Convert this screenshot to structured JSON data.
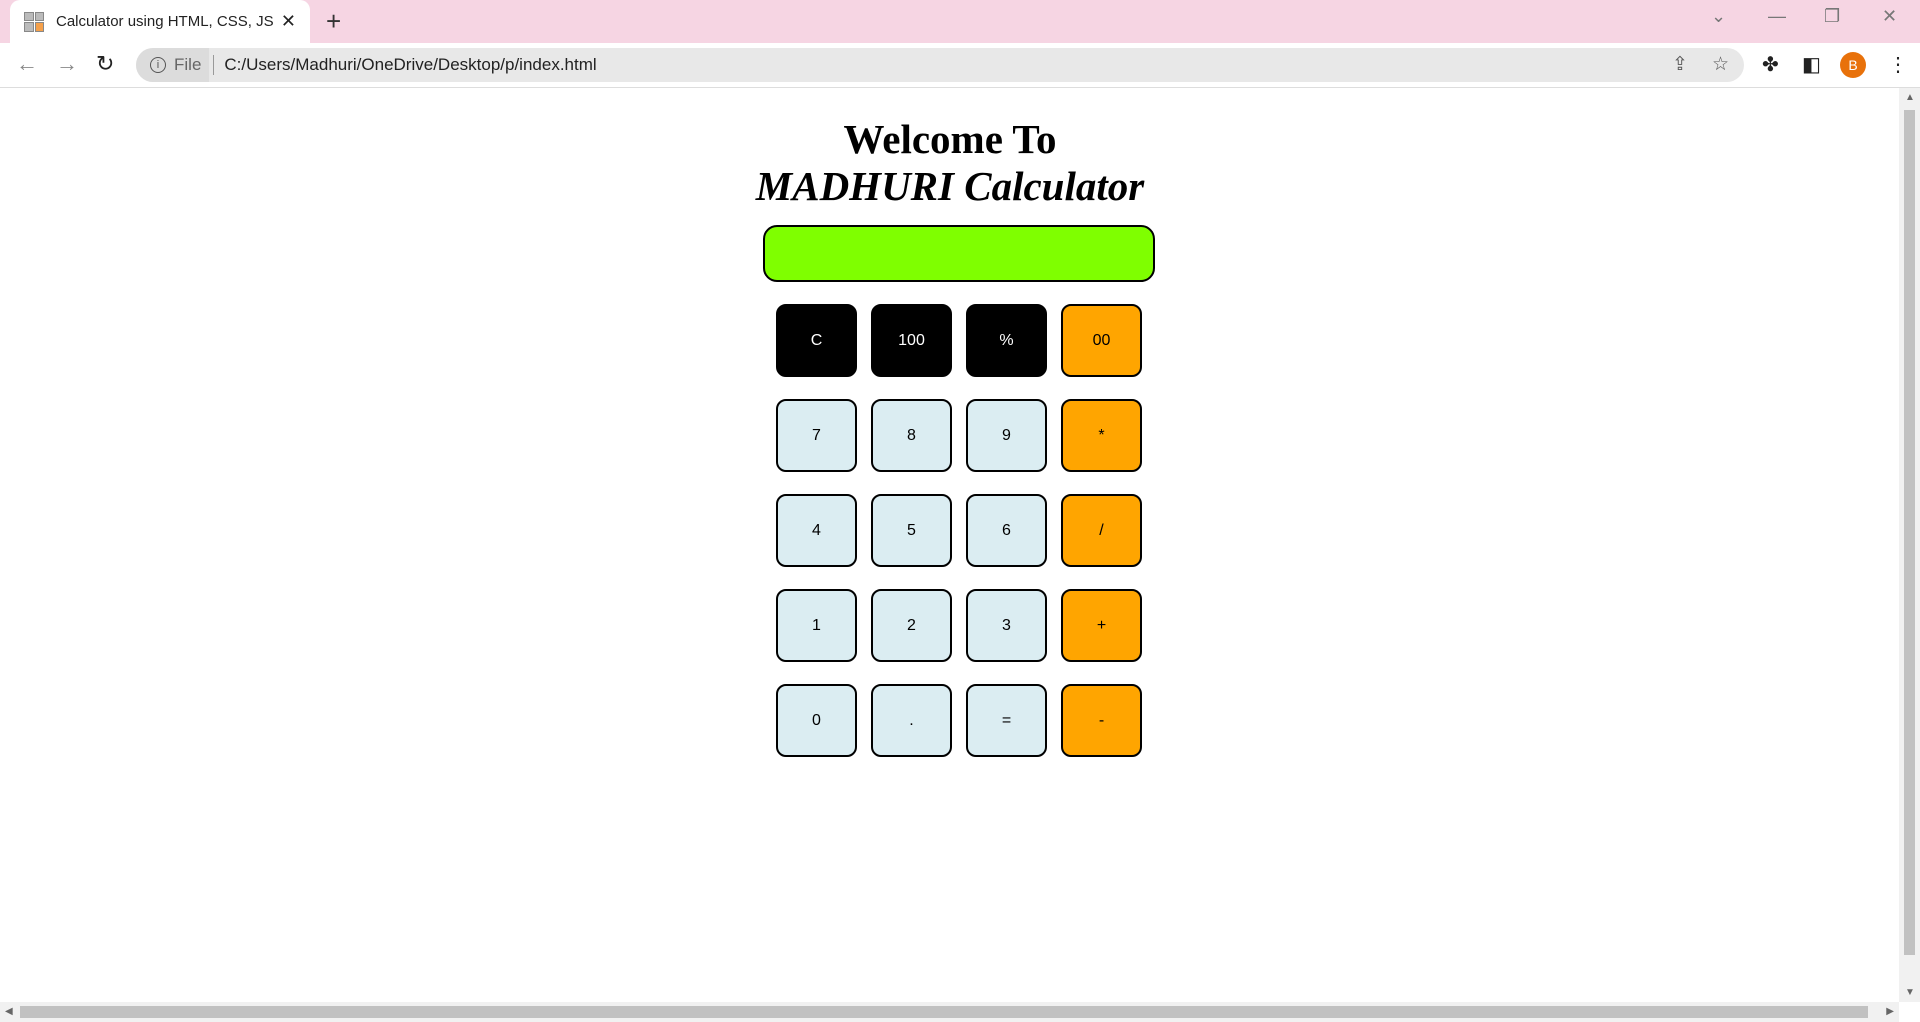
{
  "browser": {
    "tab_title": "Calculator using HTML, CSS, JS",
    "new_tab": "+",
    "close": "✕",
    "file_label": "File",
    "url": "C:/Users/Madhuri/OneDrive/Desktop/p/index.html",
    "profile_initial": "B"
  },
  "page": {
    "heading_line1": "Welcome To",
    "heading_line2": "MADHURI Calculator",
    "display_value": ""
  },
  "buttons": [
    {
      "label": "C",
      "style": "dark"
    },
    {
      "label": "100",
      "style": "dark"
    },
    {
      "label": "%",
      "style": "dark"
    },
    {
      "label": "00",
      "style": "op"
    },
    {
      "label": "7",
      "style": "num"
    },
    {
      "label": "8",
      "style": "num"
    },
    {
      "label": "9",
      "style": "num"
    },
    {
      "label": "*",
      "style": "op"
    },
    {
      "label": "4",
      "style": "num"
    },
    {
      "label": "5",
      "style": "num"
    },
    {
      "label": "6",
      "style": "num"
    },
    {
      "label": "/",
      "style": "op"
    },
    {
      "label": "1",
      "style": "num"
    },
    {
      "label": "2",
      "style": "num"
    },
    {
      "label": "3",
      "style": "num"
    },
    {
      "label": "+",
      "style": "op"
    },
    {
      "label": "0",
      "style": "num"
    },
    {
      "label": ".",
      "style": "num"
    },
    {
      "label": "=",
      "style": "num"
    },
    {
      "label": "-",
      "style": "op"
    }
  ],
  "colors": {
    "display": "#7fff00",
    "operator": "#ffa500",
    "number": "#dbedf2",
    "dark": "#000000"
  }
}
